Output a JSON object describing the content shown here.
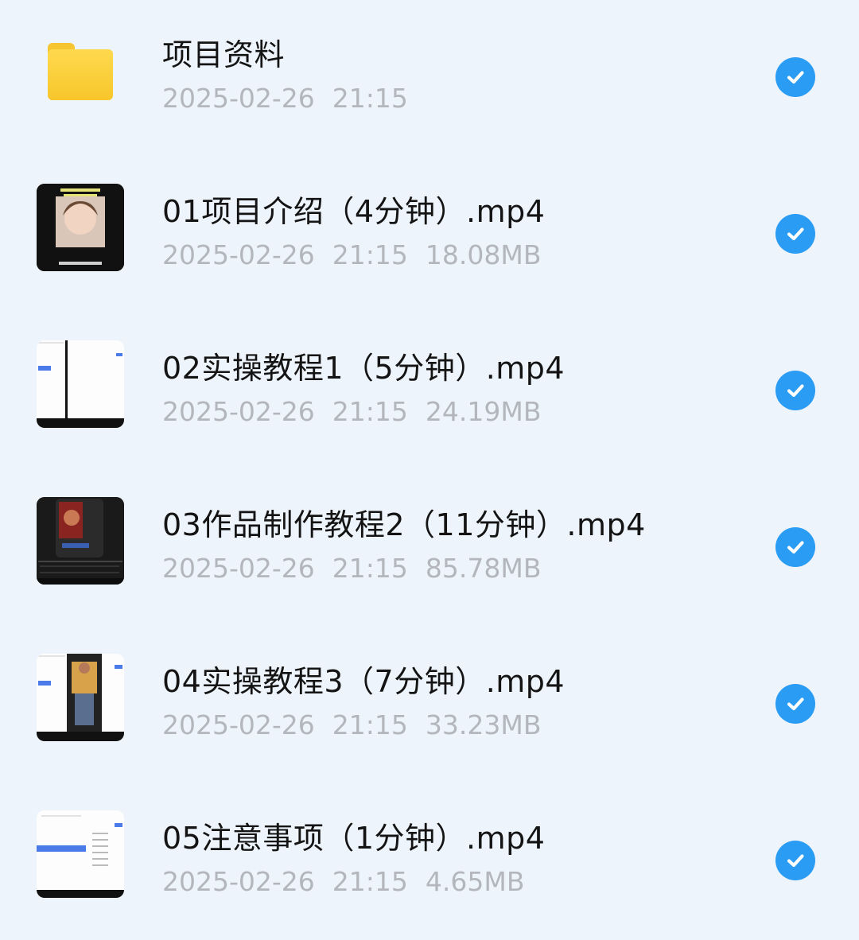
{
  "accent_color": "#2a9cf3",
  "items": [
    {
      "name": "项目资料",
      "date": "2025-02-26",
      "time": "21:15",
      "size": "",
      "icon": "folder-icon"
    },
    {
      "name": "01项目介绍（4分钟）.mp4",
      "date": "2025-02-26",
      "time": "21:15",
      "size": "18.08MB",
      "icon": "video-thumbnail"
    },
    {
      "name": "02实操教程1（5分钟）.mp4",
      "date": "2025-02-26",
      "time": "21:15",
      "size": "24.19MB",
      "icon": "video-thumbnail"
    },
    {
      "name": "03作品制作教程2（11分钟）.mp4",
      "date": "2025-02-26",
      "time": "21:15",
      "size": "85.78MB",
      "icon": "video-thumbnail"
    },
    {
      "name": "04实操教程3（7分钟）.mp4",
      "date": "2025-02-26",
      "time": "21:15",
      "size": "33.23MB",
      "icon": "video-thumbnail"
    },
    {
      "name": "05注意事项（1分钟）.mp4",
      "date": "2025-02-26",
      "time": "21:15",
      "size": "4.65MB",
      "icon": "video-thumbnail"
    }
  ]
}
